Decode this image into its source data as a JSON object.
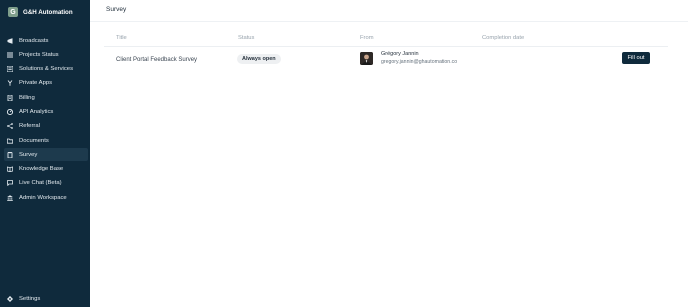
{
  "brand": {
    "name": "G&H Automation",
    "logo_letter": "G"
  },
  "sidebar": {
    "items": [
      {
        "label": "Broadcasts",
        "icon": "megaphone-icon"
      },
      {
        "label": "Projects Status",
        "icon": "list-icon"
      },
      {
        "label": "Solutions & Services",
        "icon": "layers-icon"
      },
      {
        "label": "Private Apps",
        "icon": "fork-icon"
      },
      {
        "label": "Billing",
        "icon": "receipt-icon"
      },
      {
        "label": "API Analytics",
        "icon": "gauge-icon"
      },
      {
        "label": "Referral",
        "icon": "share-icon"
      },
      {
        "label": "Documents",
        "icon": "folder-icon"
      },
      {
        "label": "Survey",
        "icon": "clipboard-icon",
        "active": true
      },
      {
        "label": "Knowledge Base",
        "icon": "book-icon"
      },
      {
        "label": "Live Chat (Beta)",
        "icon": "chat-icon"
      },
      {
        "label": "Admin Workspace",
        "icon": "bank-icon"
      }
    ],
    "settings_label": "Settings"
  },
  "page": {
    "title": "Survey"
  },
  "table": {
    "headers": {
      "title": "Title",
      "status": "Status",
      "from": "From",
      "completion": "Completion date"
    },
    "rows": [
      {
        "title": "Client Portal Feedback Survey",
        "status": "Always open",
        "from_name": "Grégory Jannin",
        "from_email": "gregory.jannin@ghautomation.co",
        "completion_date": "",
        "action": "Fill out"
      }
    ]
  },
  "colors": {
    "sidebar_bg": "#0f2a3c",
    "active_item_bg": "#1d3a4d",
    "primary_button": "#0f2a3c"
  }
}
